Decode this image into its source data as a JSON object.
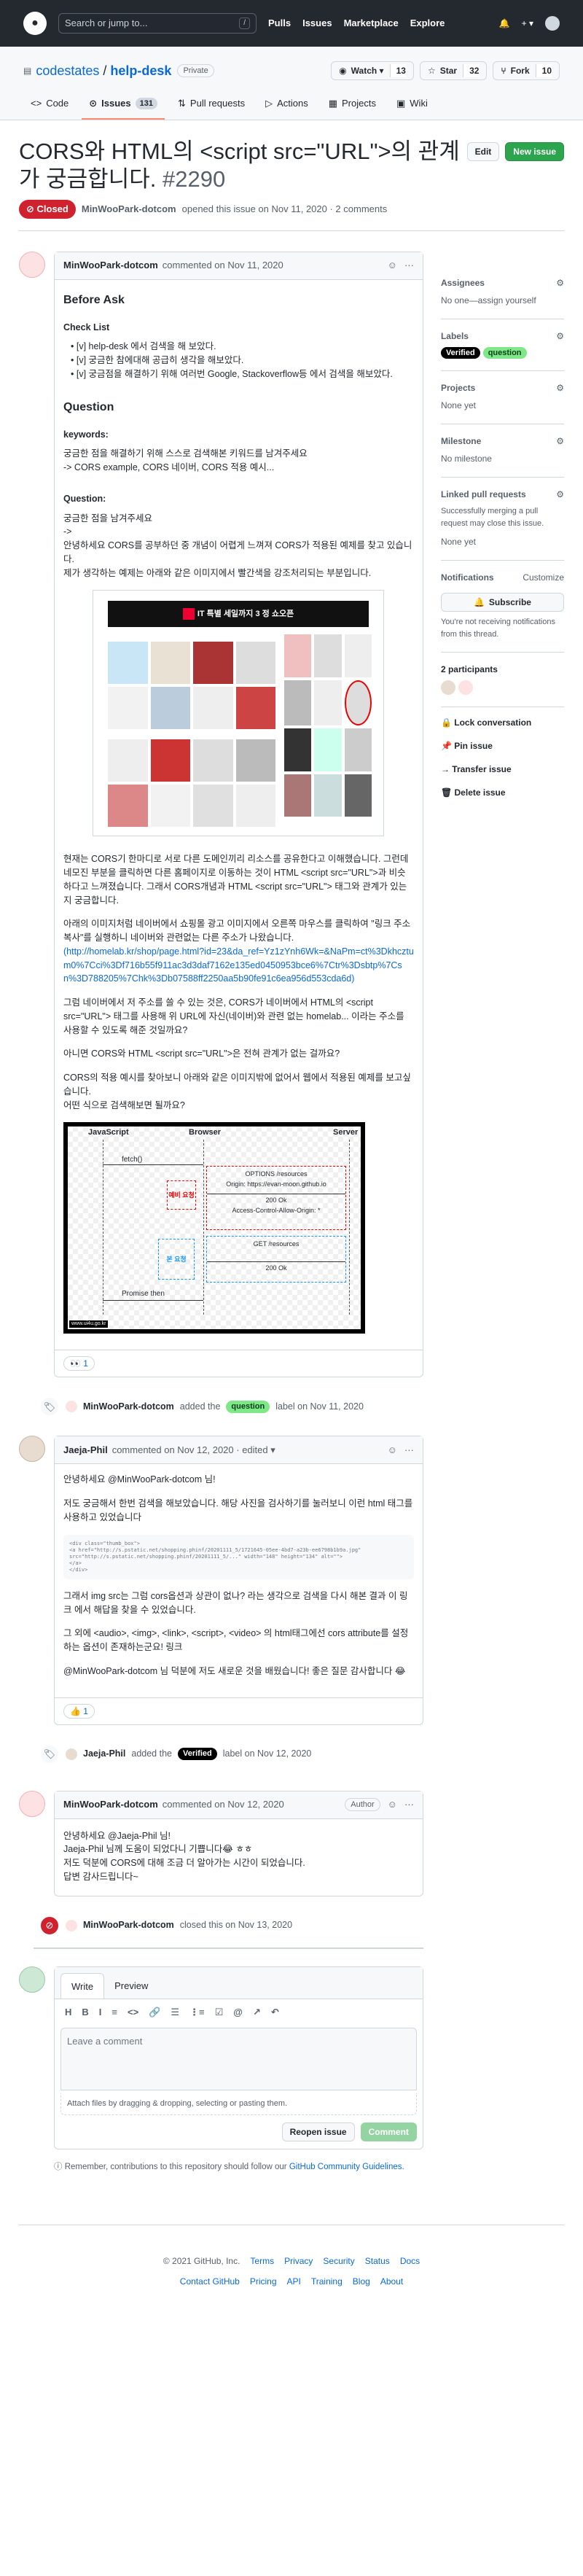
{
  "header": {
    "search_placeholder": "Search or jump to...",
    "slash": "/",
    "nav": [
      "Pulls",
      "Issues",
      "Marketplace",
      "Explore"
    ],
    "plus": "+ ▾"
  },
  "repo": {
    "owner": "codestates",
    "sep": " / ",
    "name": "help-desk",
    "visibility": "Private",
    "watch": {
      "label": "Watch ▾",
      "count": "13"
    },
    "star": {
      "label": "Star",
      "count": "32"
    },
    "fork": {
      "label": "Fork",
      "count": "10"
    },
    "tabs": [
      {
        "label": "Code",
        "icon": "code-icon"
      },
      {
        "label": "Issues",
        "count": "131",
        "icon": "issue-icon"
      },
      {
        "label": "Pull requests",
        "icon": "pr-icon"
      },
      {
        "label": "Actions",
        "icon": "actions-icon"
      },
      {
        "label": "Projects",
        "icon": "projects-icon"
      },
      {
        "label": "Wiki",
        "icon": "wiki-icon"
      }
    ]
  },
  "issue": {
    "title": "CORS와 HTML의 <script src=\"URL\">의 관계가 궁금합니다.",
    "number": "#2290",
    "edit": "Edit",
    "new_issue": "New issue",
    "state": "Closed",
    "author": "MinWooPark-dotcom",
    "opened": "opened this issue on Nov 11, 2020 · 2 comments"
  },
  "comment1": {
    "author": "MinWooPark-dotcom",
    "time": "commented on Nov 11, 2020",
    "before_ask": "Before Ask",
    "checklist_title": "Check List",
    "checklist": [
      "[v] help-desk 에서 검색을 해 보았다.",
      "[v] 궁금한 참에대해 공급히 생각을 해보았다.",
      "[v] 궁금점을 해결하기 위해 여러번 Google, Stackoverflow등 에서 검색을 해보았다."
    ],
    "question": "Question",
    "keywords_title": "keywords:",
    "keywords_text1": "궁금한 점을 해결하기 위해 스스로 검색해본 키워드를 남겨주세요",
    "keywords_text2": "-> CORS example, CORS 네이버, CORS 적용 예시...",
    "question_title": "Question:",
    "q1": "궁금한 점을 남겨주세요",
    "q2": "->",
    "q3": "안녕하세요 CORS를 공부하던 중 개념이 어렵게 느껴져 CORS가 적용된 예제를 찾고 있습니다.",
    "q4": "제가 생각하는 예제는 아래와 같은 이미지에서 빨간색을 강조처리되는 부분입니다.",
    "p1": "현재는 CORS기 한마디로 서로 다른 도메인끼리 리소스를 공유한다고 이해했습니다. 그런데 네모진 부분을 클릭하면 다른 홈페이지로 이동하는 것이 HTML <script src=\"URL\">과 비슷하다고 느껴졌습니다. 그래서 CORS개념과 HTML <script src=\"URL\"> 태그와 관계가 있는지 궁금합니다.",
    "p2": "아래의 이미지처럼 네이버에서 쇼핑몰 광고 이미지에서 오른쪽 마우스를 클릭하여 \"링크 주소 복사\"를 실행하니 네이버와 관련없는 다른 주소가 나왔습니다.",
    "link": "(http://homelab.kr/shop/page.html?id=23&da_ref=Yz1zYnh6Wk=&NaPm=ct%3Dkhcztum0%7Cci%3Df716b55f911ac3d3daf7162e135ed0450953bce6%7Ctr%3Dsbtp%7Csn%3D788205%7Chk%3Db07588ff2250aa5b90fe91c6ea956d553cda6d)",
    "p3": "그럼 네이버에서 저 주소를 쓸 수 있는 것은, CORS가 네이버에서 HTML의 <script src=\"URL\"> 태그를 사용해 위 URL에 자신(네이버)와 관련 없는 homelab... 이라는 주소를 사용할 수 있도록 해준 것일까요?",
    "p4": "아니면 CORS와 HTML <script src=\"URL\">은 전혀 관계가 없는 걸까요?",
    "p5": "CORS의 적용 예시를 찾아보니 아래와 같은 이미지밖에 없어서 웹에서 적용된 예제를 보고싶습니다.",
    "p6": "어떤 식으로 검색해보면 될까요?",
    "shop_banner": "IT 특별 세일까지 3 정 쇼오픈",
    "diagram": {
      "js": "JavaScript",
      "browser": "Browser",
      "server": "Server",
      "fetch": "fetch()",
      "preflight": "예비 요청",
      "options": "OPTIONS /resources",
      "origin": "Origin: https://evan-moon.github.io",
      "ok1": "200 Ok",
      "allow": "Access-Control-Allow-Origin: *",
      "get": "GET /resources",
      "main": "본 요청",
      "ok2": "200 Ok",
      "promise": "Promise then",
      "stamp": "www.ui4u.go.kr"
    },
    "reaction": "👀 1"
  },
  "event1": {
    "actor": "MinWooPark-dotcom",
    "action": "added the",
    "label": "question",
    "suffix": "label on Nov 11, 2020"
  },
  "comment2": {
    "author": "Jaeja-Phil",
    "time": "commented on Nov 12, 2020 · edited ▾",
    "p1": "안녕하세요 @MinWooPark-dotcom 님!",
    "p2": "저도 궁금해서 한번 검색을 해보았습니다. 해당 사진을 검사하기를 눌러보니 이런 html 태그를 사용하고 있었습니다",
    "code": [
      "<div class=\"thumb_box\">",
      "  <a href=\"http://s.pstatic.net/shopping.phinf/20201111_5/1721645-05ee-4bd7-a23b-ee6798b1b9a.jpg\"",
      "     src=\"http://s.pstatic.net/shopping.phinf/20201111_5/...\" width=\"148\" height=\"134\" alt=\"\">",
      "  </a>",
      "</div>"
    ],
    "p3": "그래서 img src는 그럼 cors옵션과 상관이 없나? 라는 생각으로 검색을 다시 해본 결과 이 링크 에서 해답을 찾을 수 있었습니다.",
    "p4": "그 외에 <audio>, <img>, <link>, <script>, <video> 의 html태그에선 cors attribute를 설정하는 옵션이 존재하는군요! 링크",
    "p5": "@MinWooPark-dotcom 님 덕분에 저도 새로운 것을 배웠습니다! 좋은 질문 감사합니다 😂",
    "reaction": "👍 1"
  },
  "event2": {
    "actor": "Jaeja-Phil",
    "action": "added the",
    "label": "Verified",
    "suffix": "label on Nov 12, 2020"
  },
  "comment3": {
    "author": "MinWooPark-dotcom",
    "time": "commented on Nov 12, 2020",
    "role": "Author",
    "p1": "안녕하세요 @Jaeja-Phil 님!",
    "p2": "Jaeja-Phil 님께 도움이 되었다니 기쁩니다😂 ㅎㅎ",
    "p3": "저도 덕분에 CORS에 대해 조금 더 알아가는 시간이 되었습니다.",
    "p4": "답변 감사드립니다~"
  },
  "event3": {
    "actor": "MinWooPark-dotcom",
    "suffix": "closed this on Nov 13, 2020"
  },
  "editor": {
    "write": "Write",
    "preview": "Preview",
    "tools": [
      "H",
      "B",
      "I",
      "≡",
      "<>",
      "🔗",
      "☰",
      "⋮≡",
      "☑",
      "@",
      "↗",
      "↶"
    ],
    "placeholder": "Leave a comment",
    "attach": "Attach files by dragging & dropping, selecting or pasting them.",
    "reopen": "Reopen issue",
    "comment": "Comment"
  },
  "remember": "Remember, contributions to this repository should follow our",
  "guidelines": "GitHub Community Guidelines.",
  "sidebar": {
    "assignees": "Assignees",
    "assignees_val": "No one—assign yourself",
    "labels": "Labels",
    "label1": "Verified",
    "label2": "question",
    "projects": "Projects",
    "projects_val": "None yet",
    "milestone": "Milestone",
    "milestone_val": "No milestone",
    "linked": "Linked pull requests",
    "linked_desc": "Successfully merging a pull request may close this issue.",
    "linked_val": "None yet",
    "notifications": "Notifications",
    "customize": "Customize",
    "subscribe": "Subscribe",
    "notif_desc": "You're not receiving notifications from this thread.",
    "participants": "2 participants",
    "lock": "Lock conversation",
    "pin": "Pin issue",
    "transfer": "Transfer issue",
    "delete": "Delete issue"
  },
  "footer": {
    "copy": "© 2021 GitHub, Inc.",
    "links1": [
      "Terms",
      "Privacy",
      "Security",
      "Status",
      "Docs"
    ],
    "links2": [
      "Contact GitHub",
      "Pricing",
      "API",
      "Training",
      "Blog",
      "About"
    ]
  },
  "colors": {
    "header": "#24292f",
    "closed": "#cf222e",
    "verified": "#000000",
    "question": "#7ee787",
    "green": "#2da44e"
  }
}
